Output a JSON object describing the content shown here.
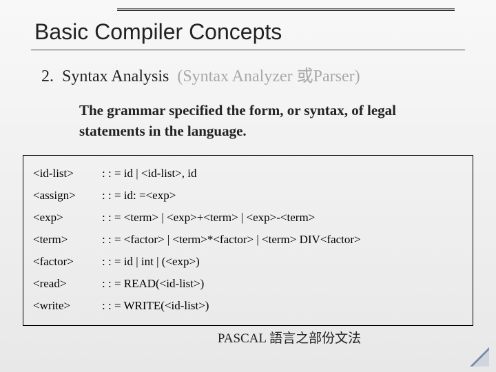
{
  "title": "Basic Compiler Concepts",
  "subtitle": {
    "num": "2.",
    "main": "Syntax Analysis",
    "gray": "(Syntax Analyzer 或Parser)"
  },
  "body": "The grammar specified the form, or syntax, of legal statements in the language.",
  "grammar": [
    {
      "lhs": "<id-list>",
      "rhs": ": : = id   |   <id-list>, id"
    },
    {
      "lhs": "<assign>",
      "rhs": ": : = id: =<exp>"
    },
    {
      "lhs": "<exp>",
      "rhs": ": : = <term>   |   <exp>+<term>   |   <exp>-<term>"
    },
    {
      "lhs": "<term>",
      "rhs": ": : = <factor> |   <term>*<factor>   |   <term> DIV<factor>"
    },
    {
      "lhs": "<factor>",
      "rhs": ": : = id   |   int   |   (<exp>)"
    },
    {
      "lhs": "<read>",
      "rhs": ": : = READ(<id-list>)"
    },
    {
      "lhs": "<write>",
      "rhs": ": : = WRITE(<id-list>)"
    }
  ],
  "footnote": "PASCAL 語言之部份文法"
}
